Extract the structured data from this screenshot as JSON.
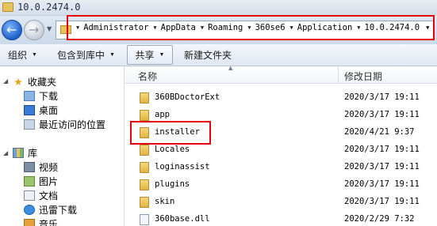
{
  "window": {
    "title": "10.0.2474.0"
  },
  "address_bar": {
    "crumbs": [
      "Administrator",
      "AppData",
      "Roaming",
      "360se6",
      "Application",
      "10.0.2474.0"
    ]
  },
  "toolbar": {
    "organize": "组织",
    "include_in_library": "包含到库中",
    "share": "共享",
    "new_folder": "新建文件夹"
  },
  "nav": {
    "favorites": "收藏夹",
    "downloads": "下载",
    "desktop": "桌面",
    "recent": "最近访问的位置",
    "libraries": "库",
    "videos": "视频",
    "pictures": "图片",
    "documents": "文档",
    "xunlei": "迅雷下载",
    "music": "音乐"
  },
  "columns": {
    "name": "名称",
    "modified": "修改日期"
  },
  "files": [
    {
      "name": "360BDoctorExt",
      "date": "2020/3/17 19:11",
      "type": "folder"
    },
    {
      "name": "app",
      "date": "2020/3/17 19:11",
      "type": "folder"
    },
    {
      "name": "installer",
      "date": "2020/4/21 9:37",
      "type": "folder"
    },
    {
      "name": "Locales",
      "date": "2020/3/17 19:11",
      "type": "folder"
    },
    {
      "name": "loginassist",
      "date": "2020/3/17 19:11",
      "type": "folder"
    },
    {
      "name": "plugins",
      "date": "2020/3/17 19:11",
      "type": "folder"
    },
    {
      "name": "skin",
      "date": "2020/3/17 19:11",
      "type": "folder"
    },
    {
      "name": "360base.dll",
      "date": "2020/2/29 7:32",
      "type": "file"
    }
  ],
  "colors": {
    "highlight": "#e8000b",
    "accent": "#1d5fc9"
  }
}
